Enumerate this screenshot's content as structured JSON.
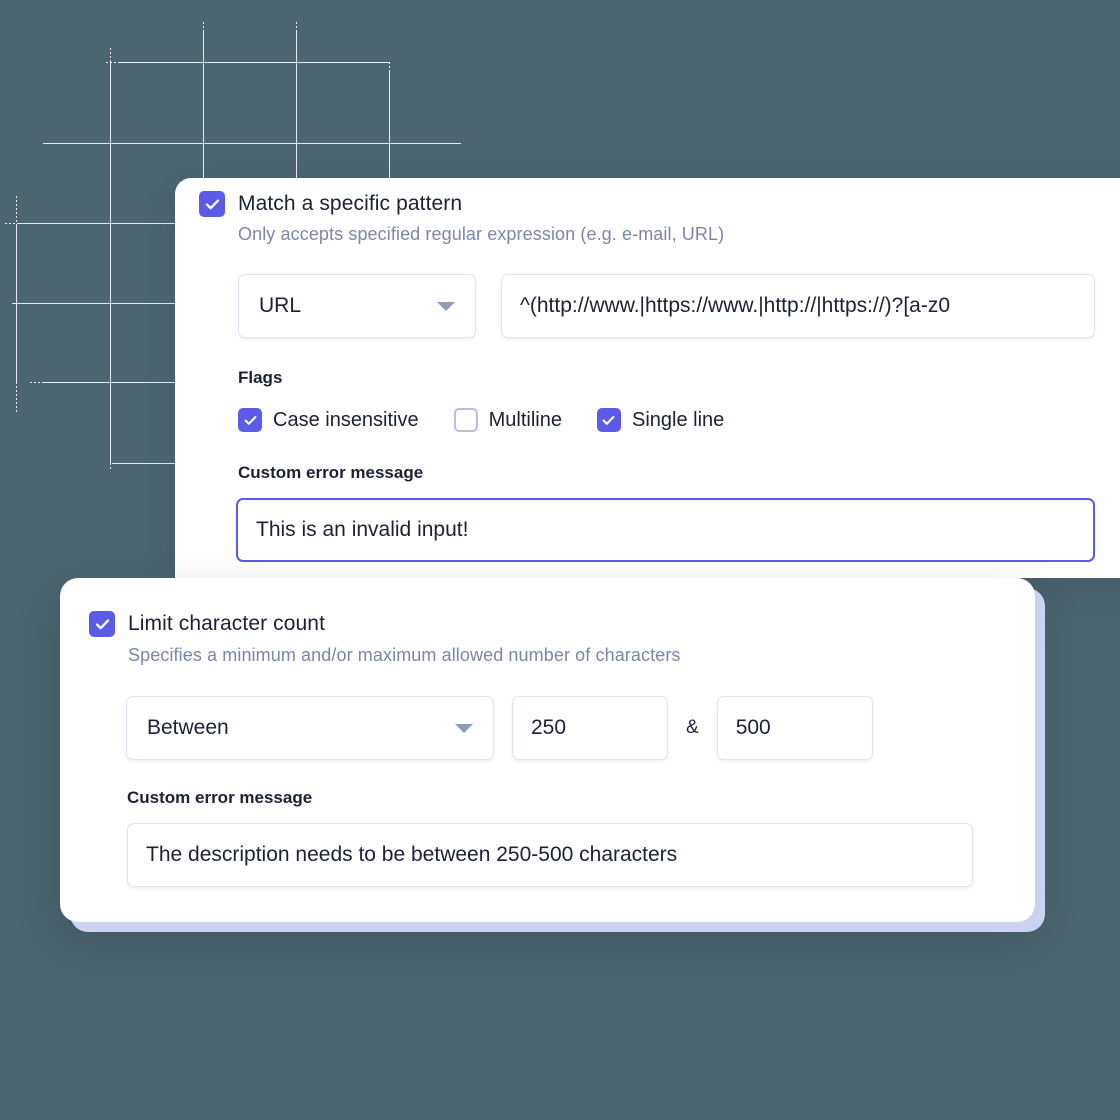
{
  "theme": {
    "background": "#4c656e",
    "accent": "#5b5be8",
    "card_background": "#ffffff",
    "card_shadow": "#ccd2f2",
    "grid_line": "#e7eaf6",
    "muted_text": "#7b86ad",
    "body_text": "#1b2233",
    "field_border": "#dfe3f2"
  },
  "pattern_card": {
    "checkbox": {
      "label": "Match a specific pattern",
      "checked": true
    },
    "subtitle": "Only accepts specified regular expression (e.g. e-mail, URL)",
    "pattern_select": {
      "value": "URL",
      "icon": "chevron-down-icon"
    },
    "regex_input": {
      "value": "^(http://www.|https://www.|http://|https://)?[a-z0"
    },
    "flags_label": "Flags",
    "flags": [
      {
        "label": "Case insensitive",
        "checked": true
      },
      {
        "label": "Multiline",
        "checked": false
      },
      {
        "label": "Single line",
        "checked": true
      }
    ],
    "error_label": "Custom error message",
    "error_input": {
      "value": "This is an invalid input!",
      "focused": true
    }
  },
  "limit_card": {
    "checkbox": {
      "label": "Limit character count",
      "checked": true
    },
    "subtitle": "Specifies a minimum and/or maximum allowed number of characters",
    "mode_select": {
      "value": "Between",
      "icon": "chevron-down-icon"
    },
    "min_input": {
      "value": "250"
    },
    "separator": "&",
    "max_input": {
      "value": "500"
    },
    "error_label": "Custom error message",
    "error_input": {
      "value": "The description needs to be between 250-500 characters",
      "focused": false
    }
  }
}
